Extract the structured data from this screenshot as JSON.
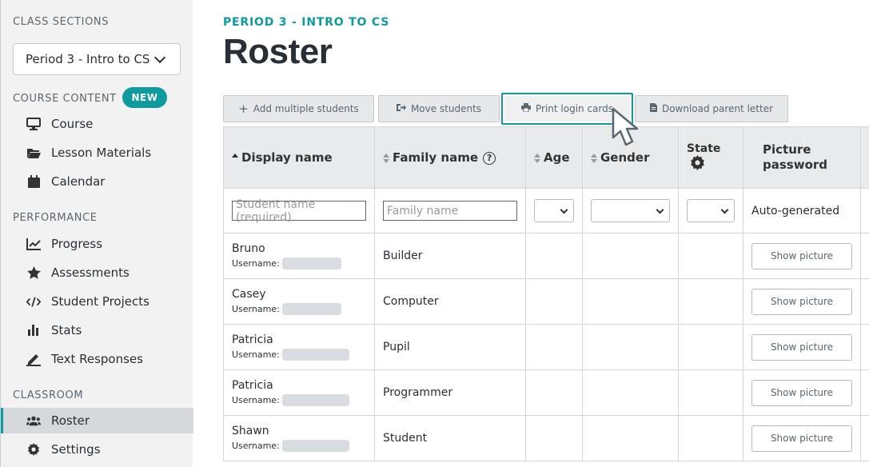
{
  "sidebar": {
    "class_sections_label": "CLASS SECTIONS",
    "selected_section": "Period 3 - Intro to CS",
    "course_content_label": "COURSE CONTENT",
    "new_badge": "NEW",
    "course_items": [
      {
        "label": "Course",
        "icon": "monitor-icon"
      },
      {
        "label": "Lesson Materials",
        "icon": "folder-open-icon"
      },
      {
        "label": "Calendar",
        "icon": "calendar-icon"
      }
    ],
    "performance_label": "PERFORMANCE",
    "performance_items": [
      {
        "label": "Progress",
        "icon": "line-chart-icon"
      },
      {
        "label": "Assessments",
        "icon": "star-icon"
      },
      {
        "label": "Student Projects",
        "icon": "code-icon"
      },
      {
        "label": "Stats",
        "icon": "bar-chart-icon"
      },
      {
        "label": "Text Responses",
        "icon": "pencil-icon"
      }
    ],
    "classroom_label": "CLASSROOM",
    "classroom_items": [
      {
        "label": "Roster",
        "icon": "users-icon",
        "active": true
      },
      {
        "label": "Settings",
        "icon": "gear-icon"
      }
    ]
  },
  "header": {
    "period": "PERIOD 3 - INTRO TO CS",
    "title": "Roster"
  },
  "toolbar": {
    "add_multiple": "Add multiple students",
    "move_students": "Move students",
    "print_login_cards": "Print login cards",
    "download_parent_letter": "Download parent letter"
  },
  "table": {
    "columns": [
      "Display name",
      "Family name",
      "Age",
      "Gender",
      "State",
      "Picture password"
    ],
    "filters": {
      "display_name_placeholder": "Student name (required)",
      "family_name_placeholder": "Family name",
      "picture_password": "Auto-generated"
    },
    "username_label": "Username:",
    "show_picture_label": "Show picture",
    "rows": [
      {
        "display_name": "Bruno",
        "family_name": "Builder"
      },
      {
        "display_name": "Casey",
        "family_name": "Computer"
      },
      {
        "display_name": "Patricia",
        "family_name": "Pupil"
      },
      {
        "display_name": "Patricia",
        "family_name": "Programmer"
      },
      {
        "display_name": "Shawn",
        "family_name": "Student"
      }
    ]
  },
  "colors": {
    "accent": "#0d9ba0",
    "sidebar_bg": "#f2f2f2",
    "active_bg": "#d6d9db"
  }
}
